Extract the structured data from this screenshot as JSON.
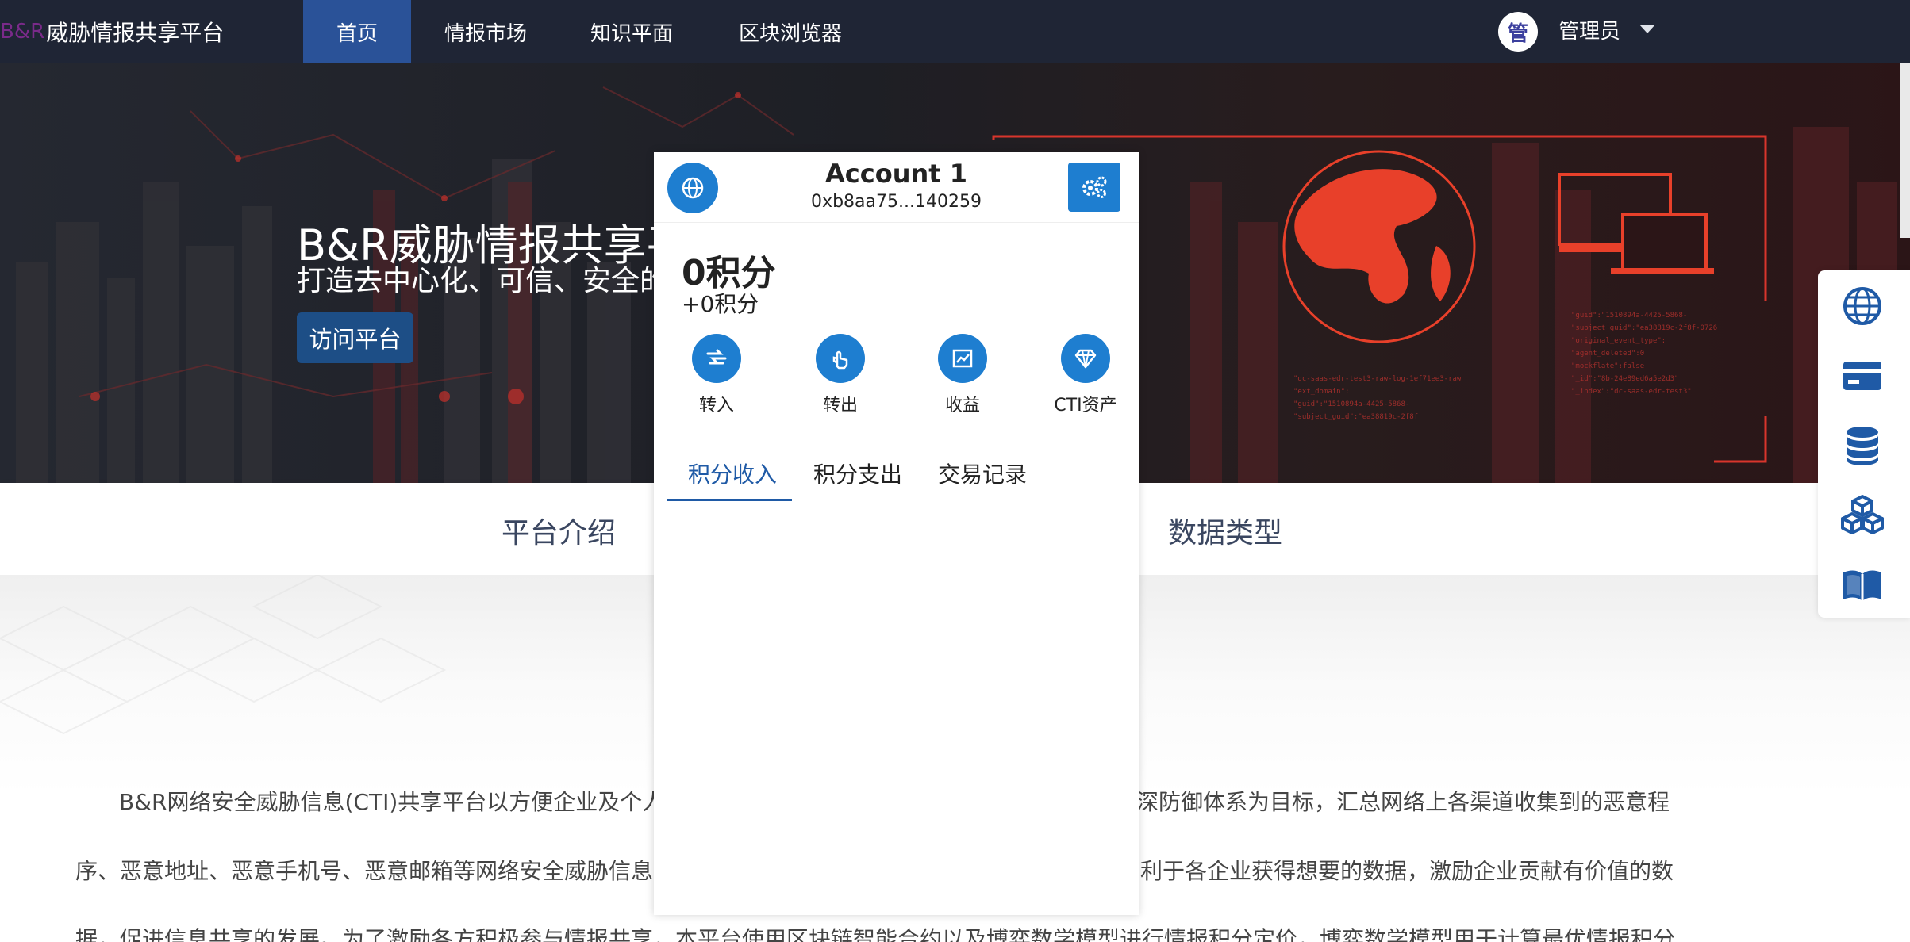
{
  "nav": {
    "brand_logo": "B&R",
    "brand_title": "威胁情报共享平台",
    "tabs": [
      {
        "label": "首页",
        "active": true
      },
      {
        "label": "情报市场"
      },
      {
        "label": "知识平面"
      },
      {
        "label": "区块浏览器"
      }
    ],
    "user_avatar": "管",
    "user_name": "管理员"
  },
  "hero": {
    "title": "B&R威胁情报共享平台",
    "subtitle": "打造去中心化、可信、安全的",
    "button": "访问平台"
  },
  "sections": [
    "平台介绍",
    "数据类型"
  ],
  "intro": {
    "lines": [
      "B&R网络安全威胁信息(CTI)共享平台以方便企业及个人",
      "深防御体系为目标，汇总网络上各渠道收集到的恶意程",
      "序、恶意地址、恶意手机号、恶意邮箱等网络安全威胁信息",
      "利于各企业获得想要的数据，激励企业贡献有价值的数",
      "据，促进信息共享的发展。为了激励各方积极参与情报共享，本平台使用区块链智能合约以及博弈数学模型进行情报积分定价，博弈数学模型用于计算最优情报积分"
    ]
  },
  "wallet": {
    "account_name": "Account 1",
    "account_address": "0xb8aa75...140259",
    "balance": "0积分",
    "balance_delta": "+0积分",
    "actions": [
      {
        "label": "转入",
        "icon": "transfer-in-icon"
      },
      {
        "label": "转出",
        "icon": "transfer-out-icon"
      },
      {
        "label": "收益",
        "icon": "earnings-chart-icon"
      },
      {
        "label": "CTI资产",
        "icon": "diamond-icon"
      }
    ],
    "tabs": [
      {
        "label": "积分收入",
        "active": true
      },
      {
        "label": "积分支出"
      },
      {
        "label": "交易记录"
      }
    ]
  },
  "side_toolbar": {
    "icons": [
      "globe-icon",
      "card-icon",
      "database-icon",
      "cubes-icon",
      "book-icon"
    ]
  },
  "colors": {
    "nav_bg": "#1f2535",
    "nav_active": "#2a5298",
    "wallet_accent": "#1e7ed0",
    "tab_active": "#1f5aa6",
    "hero_red": "#e8402a"
  }
}
